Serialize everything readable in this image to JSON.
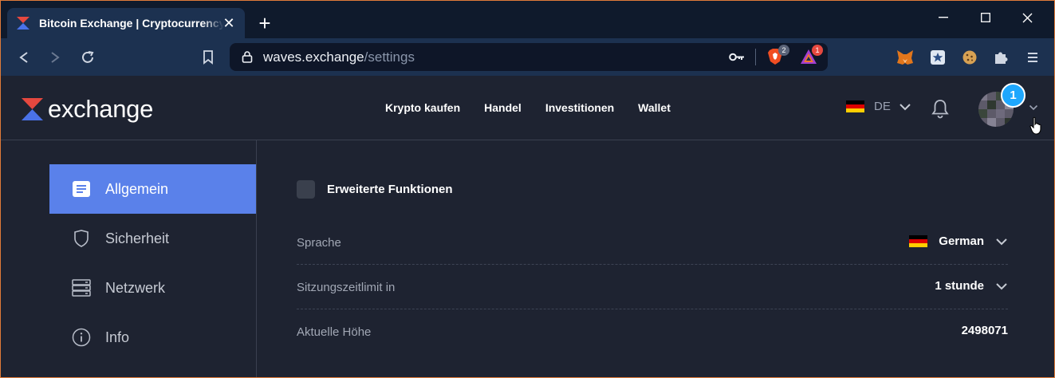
{
  "browser": {
    "tab_title": "Bitcoin Exchange | Cryptocurrency Exchange",
    "tab_close": "✕",
    "newtab": "+",
    "url_host": "waves.exchange",
    "url_path": "/settings",
    "brave_badge": "2",
    "rewards_badge": "1"
  },
  "header": {
    "logo_text": "exchange",
    "nav": [
      "Krypto kaufen",
      "Handel",
      "Investitionen",
      "Wallet"
    ],
    "language_code": "DE",
    "notification_count": "1"
  },
  "sidebar": {
    "items": [
      {
        "label": "Allgemein",
        "icon": "list-icon",
        "active": true
      },
      {
        "label": "Sicherheit",
        "icon": "shield-icon",
        "active": false
      },
      {
        "label": "Netzwerk",
        "icon": "server-icon",
        "active": false
      },
      {
        "label": "Info",
        "icon": "info-icon",
        "active": false
      }
    ]
  },
  "settings": {
    "advanced_label": "Erweiterte Funktionen",
    "advanced_checked": false,
    "rows": [
      {
        "label": "Sprache",
        "value": "German"
      },
      {
        "label": "Sitzungszeitlimit in",
        "value": "1 stunde"
      },
      {
        "label": "Aktuelle Höhe",
        "value": "2498071"
      }
    ]
  },
  "colors": {
    "accent": "#5a81ea",
    "background": "#1e2331",
    "browser_toolbar": "#1c3150",
    "badge": "#1ea7fd"
  }
}
